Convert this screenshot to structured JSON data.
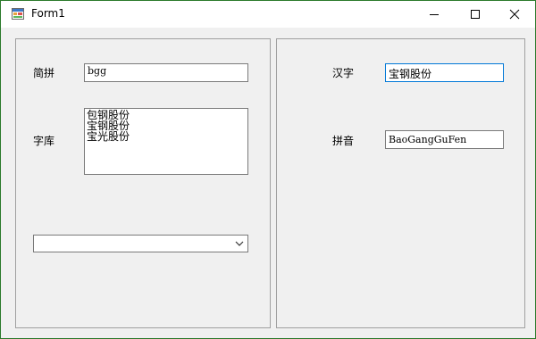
{
  "window": {
    "title": "Form1"
  },
  "left_panel": {
    "jianpin_label": "简拼",
    "jianpin_value": "bgg",
    "ziku_label": "字库",
    "ziku_items": [
      "包钢股份",
      "宝钢股份",
      "宝光股份"
    ],
    "combo_value": ""
  },
  "right_panel": {
    "hanzi_label": "汉字",
    "hanzi_value": "宝钢股份",
    "pinyin_label": "拼音",
    "pinyin_value": "BaoGangGuFen"
  },
  "colors": {
    "focus_border": "#0078d7",
    "window_border": "#2b7a2b",
    "client_bg": "#f0f0f0"
  },
  "icons": {
    "app": "form-app-icon",
    "minimize": "minimize-icon",
    "maximize": "maximize-icon",
    "close": "close-icon",
    "dropdown": "chevron-down-icon"
  }
}
